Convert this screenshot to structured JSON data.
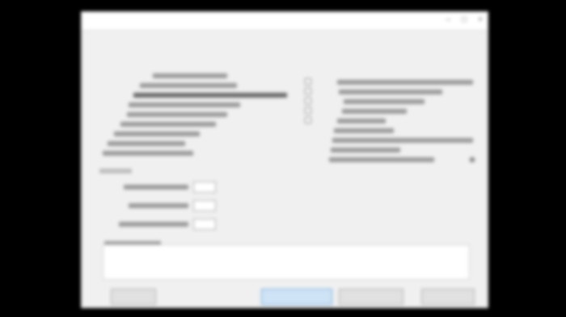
{
  "window": {
    "title": "",
    "controls": [
      "–",
      "□",
      "×"
    ]
  },
  "menu": [
    "",
    "",
    "",
    "",
    ""
  ],
  "left_group": {
    "title": ""
  },
  "right_group": {
    "title": ""
  },
  "bottom_group": {
    "title": ""
  },
  "buttons": {
    "help": "",
    "ok": "",
    "cancel": "",
    "apply": ""
  },
  "colors": {
    "window_bg": "#f0f0f0",
    "primary_button": "#cfe3f7",
    "primary_border": "#6ea6dc"
  }
}
